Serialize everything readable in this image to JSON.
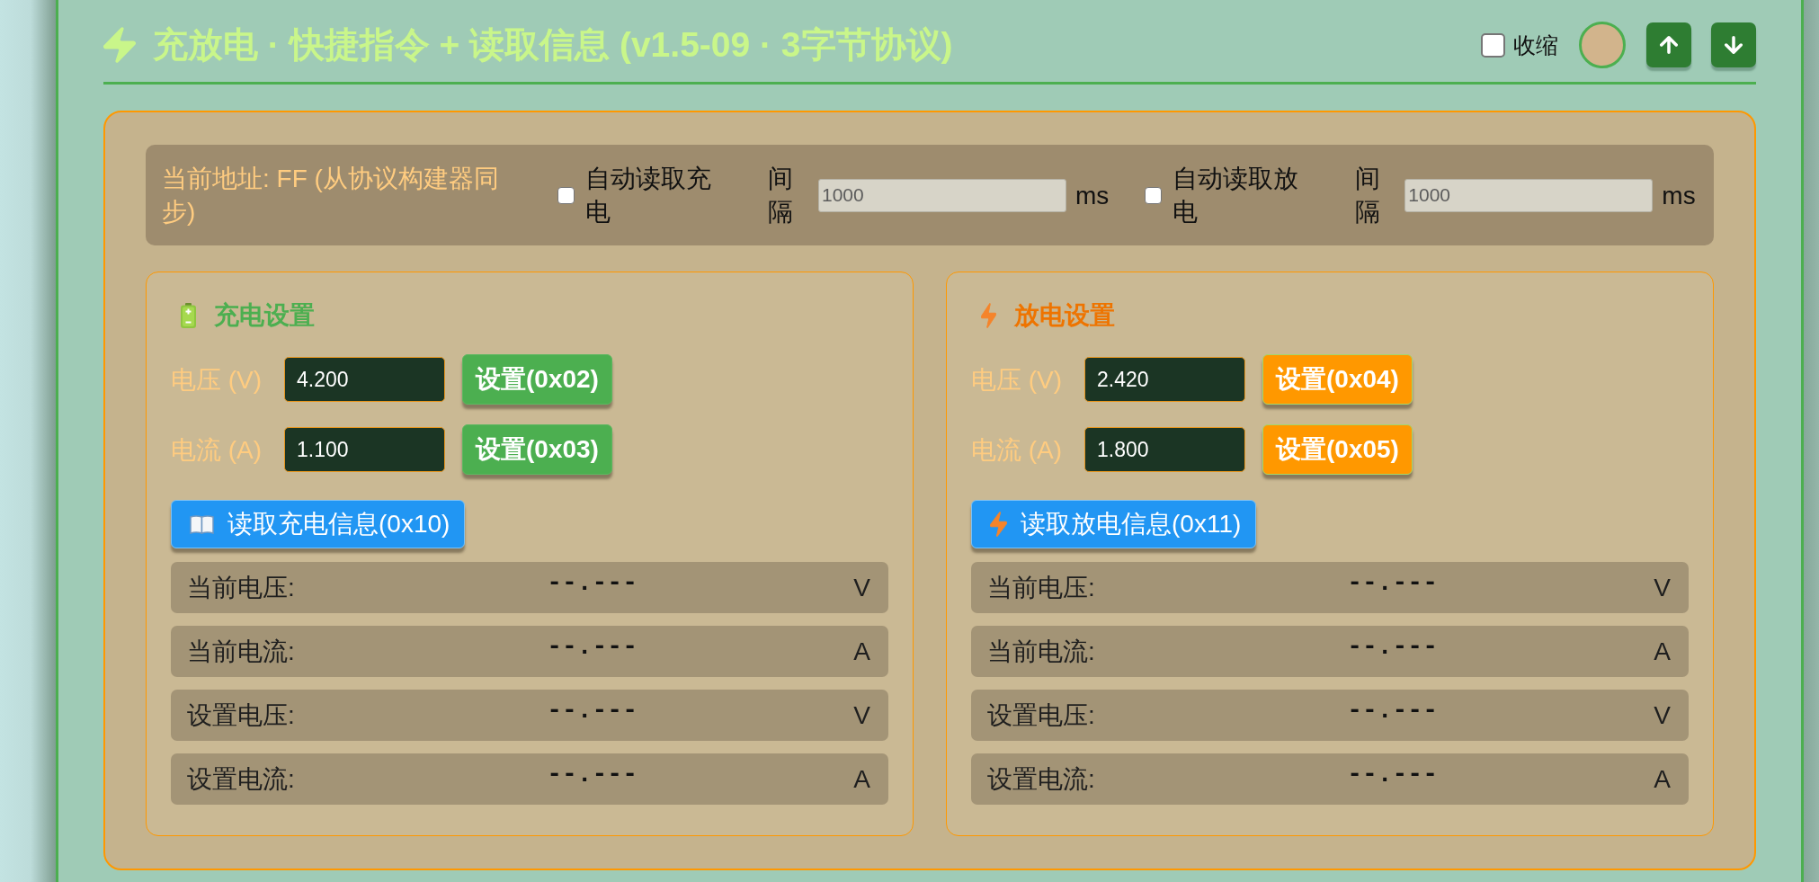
{
  "header": {
    "title": "充放电 · 快捷指令 + 读取信息 (v1.5-09 · 3字节协议)",
    "collapse": {
      "label": "收缩",
      "checked": false
    }
  },
  "address_bar": {
    "address": "当前地址: FF (从协议构建器同步)",
    "auto_reads": [
      {
        "label": "自动读取充电",
        "checked": false,
        "interval_label": "间隔",
        "interval": "1000",
        "unit": "ms"
      },
      {
        "label": "自动读取放电",
        "checked": false,
        "interval_label": "间隔",
        "interval": "1000",
        "unit": "ms"
      }
    ]
  },
  "panels": [
    {
      "kind": "charge",
      "title": "充电设置",
      "settings": [
        {
          "label": "电压 (V)",
          "value": "4.200",
          "button": "设置(0x02)"
        },
        {
          "label": "电流 (A)",
          "value": "1.100",
          "button": "设置(0x03)"
        }
      ],
      "read_button": "读取充电信息(0x10)",
      "readings": [
        {
          "label": "当前电压:",
          "value": "--.---",
          "unit": "V"
        },
        {
          "label": "当前电流:",
          "value": "--.---",
          "unit": "A"
        },
        {
          "label": "设置电压:",
          "value": "--.---",
          "unit": "V"
        },
        {
          "label": "设置电流:",
          "value": "--.---",
          "unit": "A"
        }
      ]
    },
    {
      "kind": "discharge",
      "title": "放电设置",
      "settings": [
        {
          "label": "电压 (V)",
          "value": "2.420",
          "button": "设置(0x04)"
        },
        {
          "label": "电流 (A)",
          "value": "1.800",
          "button": "设置(0x05)"
        }
      ],
      "read_button": "读取放电信息(0x11)",
      "readings": [
        {
          "label": "当前电压:",
          "value": "--.---",
          "unit": "V"
        },
        {
          "label": "当前电流:",
          "value": "--.---",
          "unit": "A"
        },
        {
          "label": "设置电压:",
          "value": "--.---",
          "unit": "V"
        },
        {
          "label": "设置电流:",
          "value": "--.---",
          "unit": "A"
        }
      ]
    }
  ]
}
